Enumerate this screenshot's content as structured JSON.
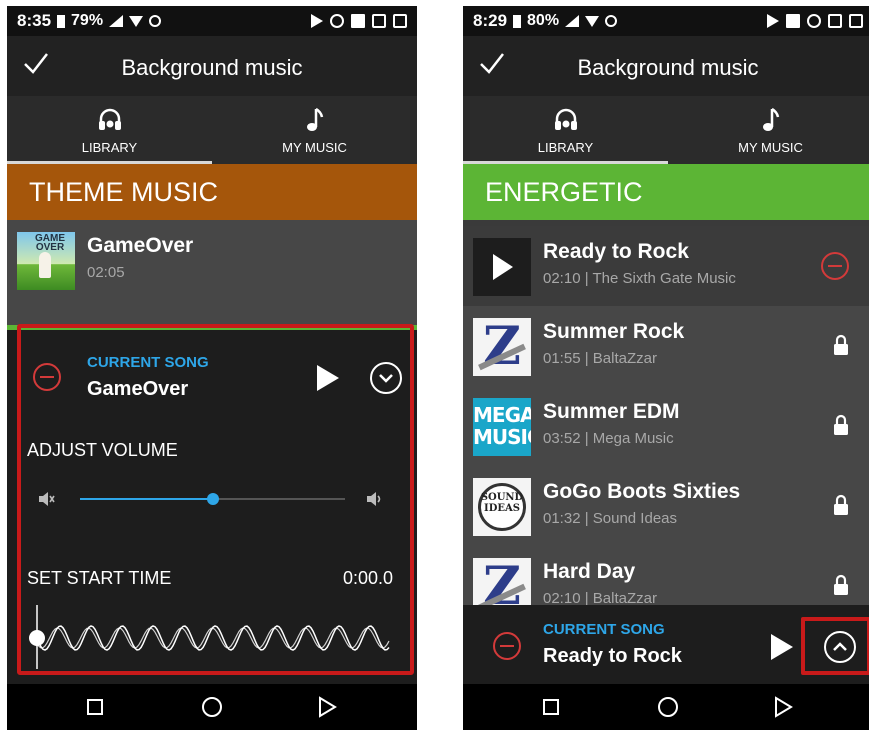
{
  "left": {
    "status": {
      "time": "8:35",
      "battery": "79%"
    },
    "app_title": "Background music",
    "tabs": [
      {
        "label": "LIBRARY"
      },
      {
        "label": "MY MUSIC"
      }
    ],
    "category": "THEME MUSIC",
    "song": {
      "title": "GameOver",
      "duration": "02:05",
      "thumb_text": "GAME OVER"
    },
    "current": {
      "label": "CURRENT SONG",
      "title": "GameOver"
    },
    "volume": {
      "label": "ADJUST VOLUME",
      "level": 0.5
    },
    "start": {
      "label": "SET START TIME",
      "value": "0:00.0"
    }
  },
  "right": {
    "status": {
      "time": "8:29",
      "battery": "80%"
    },
    "app_title": "Background music",
    "tabs": [
      {
        "label": "LIBRARY"
      },
      {
        "label": "MY MUSIC"
      }
    ],
    "category": "ENERGETIC",
    "songs": [
      {
        "title": "Ready to Rock",
        "meta": "02:10 | The Sixth Gate Music",
        "action": "remove"
      },
      {
        "title": "Summer Rock",
        "meta": "01:55 | BaltaZzar",
        "action": "locked"
      },
      {
        "title": "Summer EDM",
        "meta": "03:52 | Mega Music",
        "action": "locked",
        "thumb_text": [
          "MEGA",
          "MUSIC"
        ]
      },
      {
        "title": "GoGo Boots Sixties",
        "meta": "01:32 | Sound Ideas",
        "action": "locked",
        "thumb_text": [
          "SOUND",
          "IDEAS"
        ]
      },
      {
        "title": "Hard Day",
        "meta": "02:10 | BaltaZzar",
        "action": "locked"
      }
    ],
    "current": {
      "label": "CURRENT SONG",
      "title": "Ready to Rock"
    }
  },
  "colors": {
    "theme_music": "#a5560b",
    "energetic": "#5cb535",
    "accent_blue": "#2ea6e8",
    "remove_red": "#d33a3a",
    "highlight_red": "#c81a1a"
  },
  "icons": [
    "check-icon",
    "headphones-icon",
    "music-note-icon",
    "remove-icon",
    "play-icon",
    "collapse-icon",
    "expand-icon",
    "mute-icon",
    "volume-icon",
    "lock-icon",
    "nav-recents-icon",
    "nav-home-icon",
    "nav-back-icon"
  ]
}
